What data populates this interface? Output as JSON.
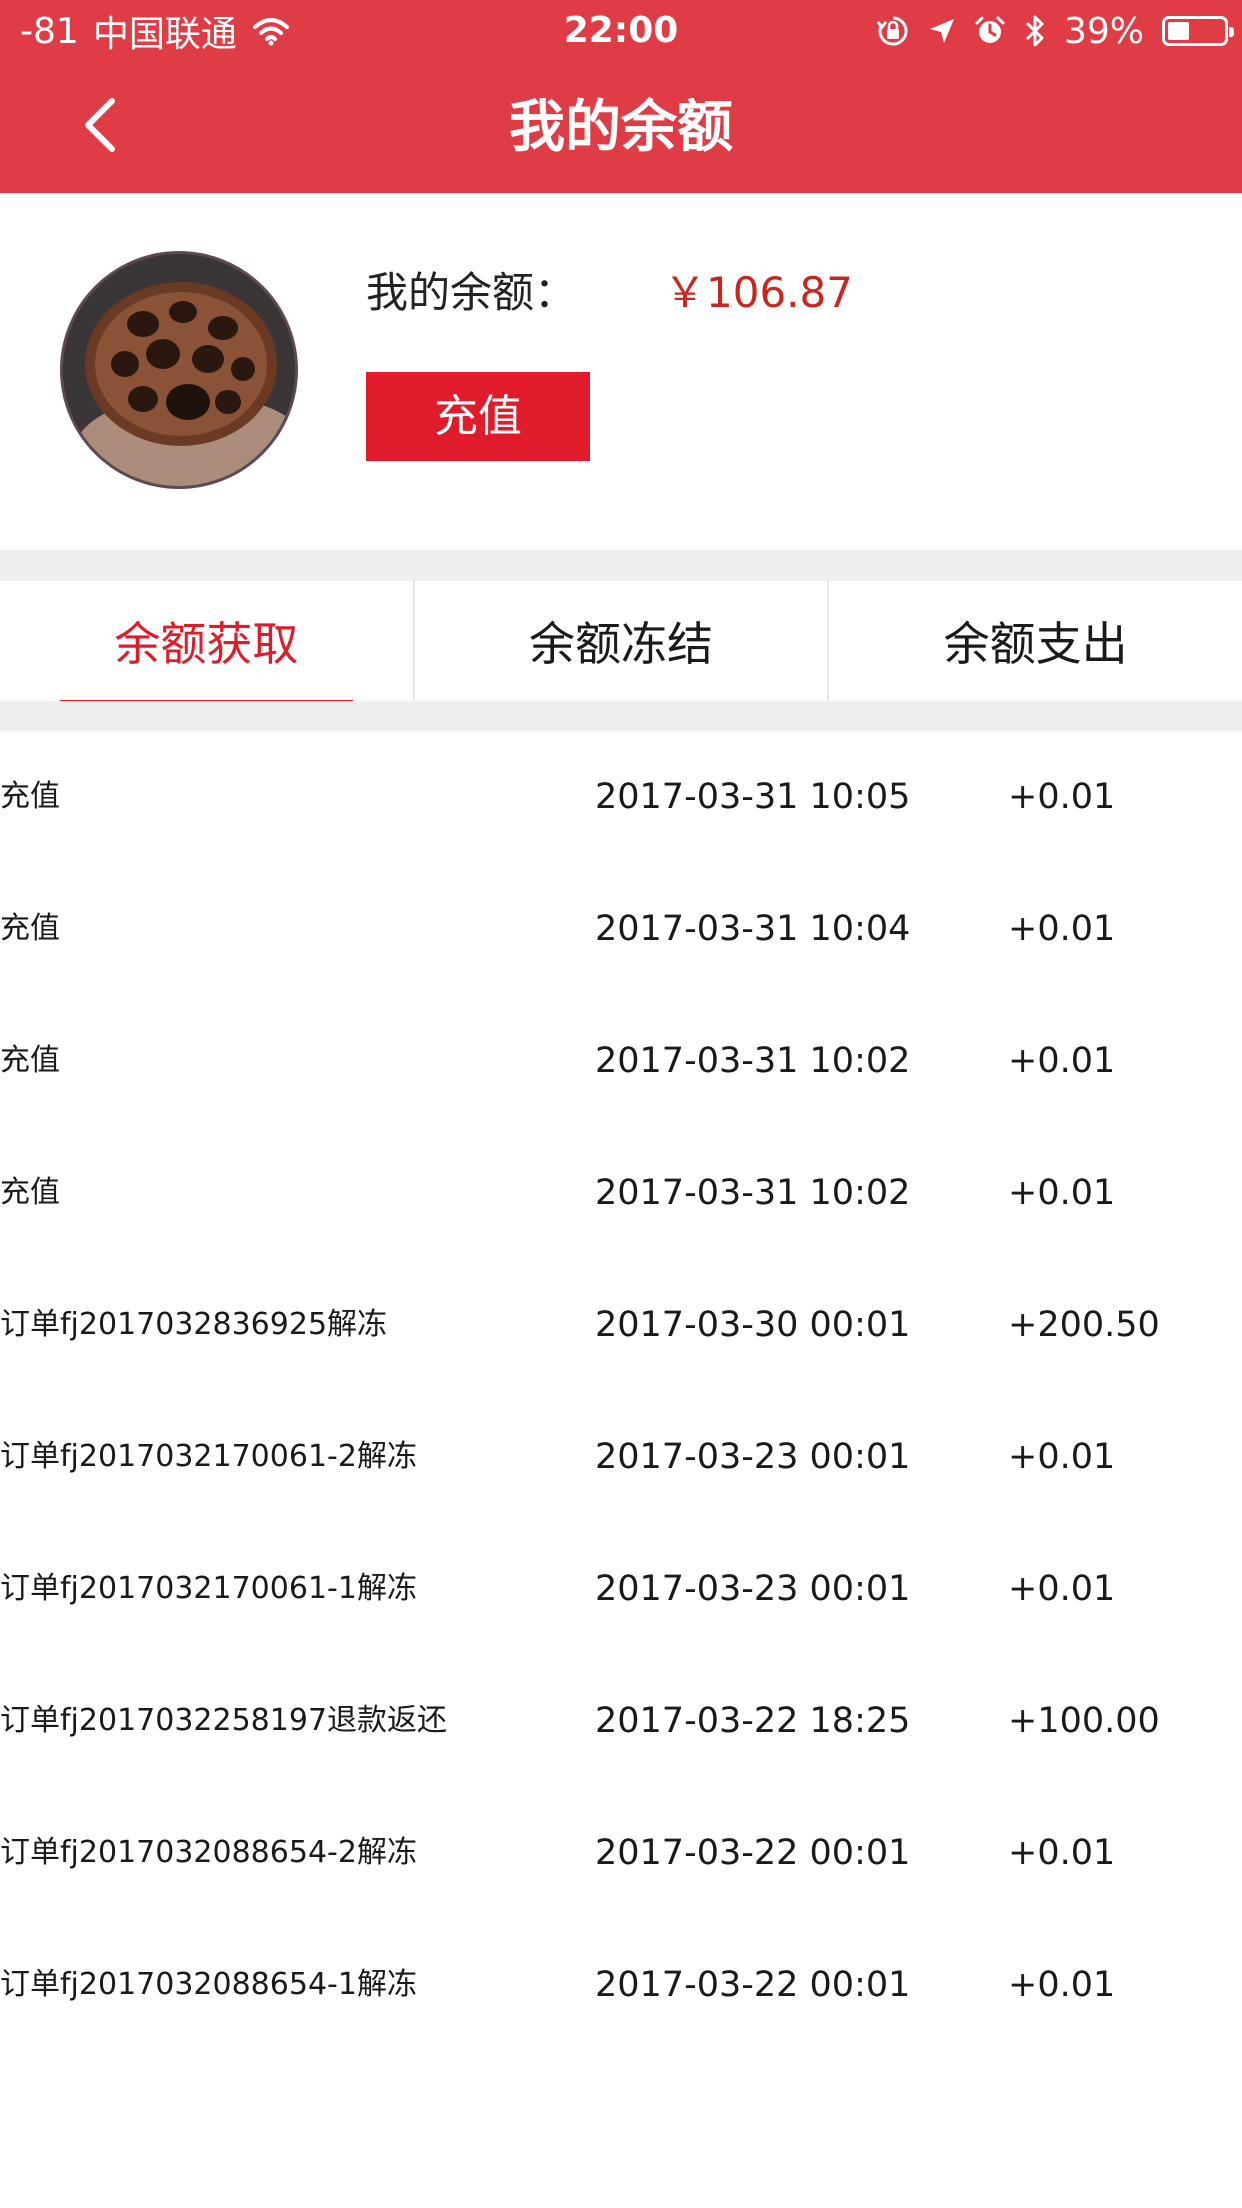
{
  "status_bar": {
    "signal": "-81",
    "carrier": "中国联通",
    "time": "22:00",
    "battery_percent": "39%",
    "battery_level": 0.39,
    "icons": [
      "wifi-icon",
      "rotation-lock-icon",
      "location-icon",
      "alarm-icon",
      "bluetooth-icon",
      "battery-icon"
    ]
  },
  "nav": {
    "title": "我的余额",
    "back_icon": "chevron-left-icon"
  },
  "balance": {
    "label": "我的余额：",
    "amount": "￥106.87",
    "recharge_label": "充值"
  },
  "tabs": [
    {
      "label": "余额获取",
      "active": true
    },
    {
      "label": "余额冻结",
      "active": false
    },
    {
      "label": "余额支出",
      "active": false
    }
  ],
  "transactions": [
    {
      "desc": "充值",
      "time": "2017-03-31 10:05",
      "amount": "+0.01"
    },
    {
      "desc": "充值",
      "time": "2017-03-31 10:04",
      "amount": "+0.01"
    },
    {
      "desc": "充值",
      "time": "2017-03-31 10:02",
      "amount": "+0.01"
    },
    {
      "desc": "充值",
      "time": "2017-03-31 10:02",
      "amount": "+0.01"
    },
    {
      "desc": "订单fj2017032836925解冻",
      "time": "2017-03-30 00:01",
      "amount": "+200.50"
    },
    {
      "desc": "订单fj2017032170061-2解冻",
      "time": "2017-03-23 00:01",
      "amount": "+0.01"
    },
    {
      "desc": "订单fj2017032170061-1解冻",
      "time": "2017-03-23 00:01",
      "amount": "+0.01"
    },
    {
      "desc": "订单fj2017032258197退款返还",
      "time": "2017-03-22 18:25",
      "amount": "+100.00"
    },
    {
      "desc": "订单fj2017032088654-2解冻",
      "time": "2017-03-22 00:01",
      "amount": "+0.01"
    },
    {
      "desc": "订单fj2017032088654-1解冻",
      "time": "2017-03-22 00:01",
      "amount": "+0.01"
    }
  ],
  "colors": {
    "header_red": "#e03c45",
    "accent_red": "#e01b2a",
    "amount_red": "#c8261e"
  }
}
